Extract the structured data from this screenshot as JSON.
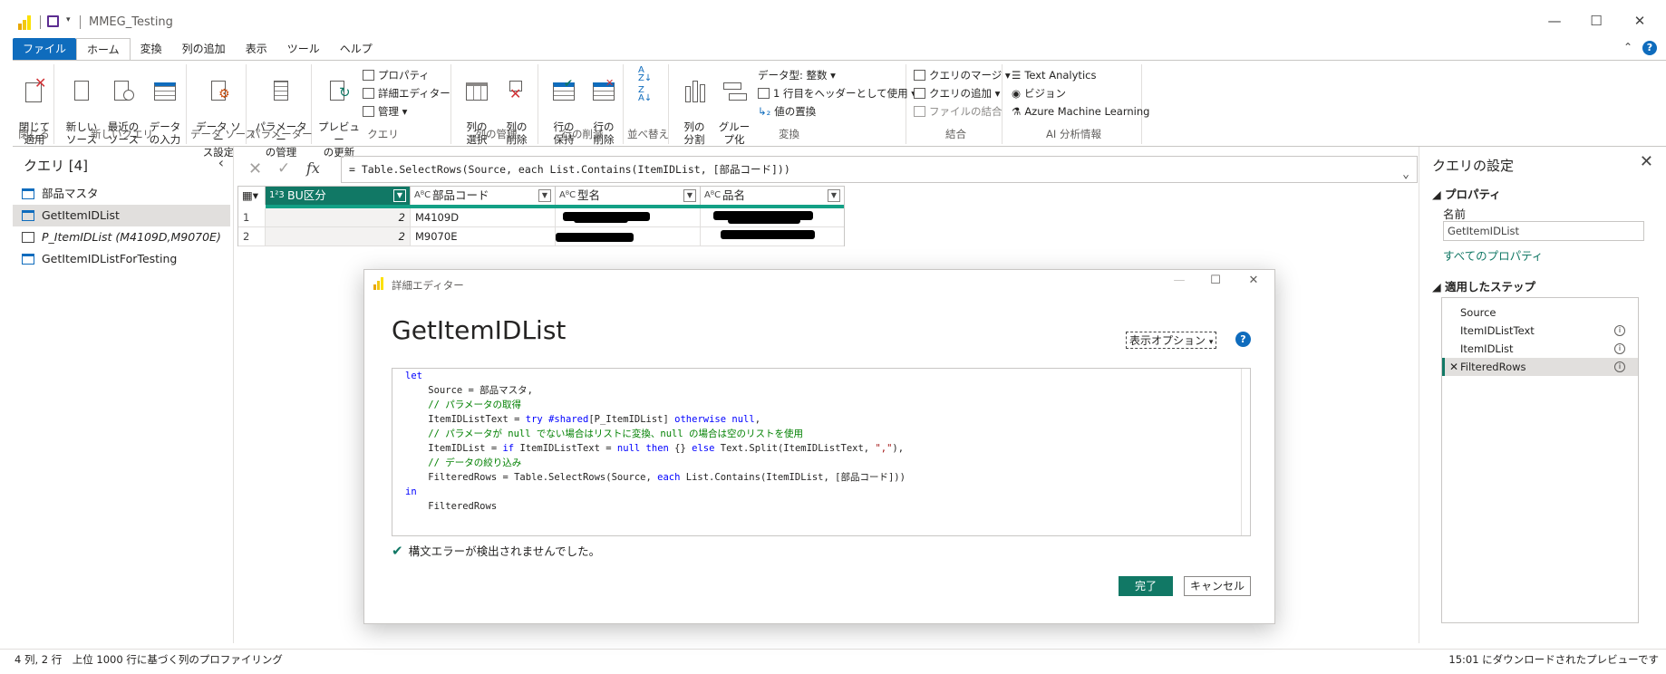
{
  "window": {
    "title": "MMEG_Testing"
  },
  "tabs": [
    "ファイル",
    "ホーム",
    "変換",
    "列の追加",
    "表示",
    "ツール",
    "ヘルプ"
  ],
  "ribbon": {
    "close_apply": "閉じて\n適用",
    "close_group": "閉じる",
    "new_source": "新しい\nソース",
    "recent_source": "最近の\nソース",
    "enter_data": "データ\nの入力",
    "new_query_group": "新しいクエリ",
    "data_source_settings": "データ ソー\nス設定",
    "data_source_group": "データ ソース",
    "manage_params": "パラメーター\nの管理",
    "params_group": "パラメーター",
    "refresh_preview": "プレビュー\nの更新",
    "properties": "プロパティ",
    "advanced_editor": "詳細エディター",
    "manage": "管理",
    "query_group": "クエリ",
    "choose_columns": "列の\n選択",
    "remove_columns": "列の\n削除",
    "manage_columns_group": "列の管理",
    "keep_rows": "行の\n保持",
    "remove_rows": "行の\n削除",
    "reduce_rows_group": "行の削減",
    "sort_group": "並べ替え",
    "split_column": "列の\n分割",
    "group_by": "グルー\nプ化",
    "data_type": "データ型: 整数",
    "first_row_header": "1 行目をヘッダーとして使用",
    "replace_values": "値の置換",
    "transform_group": "変換",
    "merge_queries": "クエリのマージ",
    "append_queries": "クエリの追加",
    "combine_files": "ファイルの結合",
    "combine_group": "結合",
    "text_analytics": "Text Analytics",
    "vision": "ビジョン",
    "azure_ml": "Azure Machine Learning",
    "ai_group": "AI 分析情報"
  },
  "queries": {
    "header": "クエリ [4]",
    "items": [
      {
        "label": "部品マスタ"
      },
      {
        "label": "GetItemIDList"
      },
      {
        "label": "P_ItemIDList (M4109D,M9070E)"
      },
      {
        "label": "GetItemIDListForTesting"
      }
    ]
  },
  "formula": {
    "fx": "fx",
    "text": "= Table.SelectRows(Source, each List.Contains(ItemIDList, [部品コード]))"
  },
  "grid": {
    "columns": [
      {
        "type": "1²3",
        "name": "BU区分"
      },
      {
        "type": "AᴮC",
        "name": "部品コード"
      },
      {
        "type": "AᴮC",
        "name": "型名"
      },
      {
        "type": "AᴮC",
        "name": "品名"
      }
    ],
    "rows": [
      {
        "n": "1",
        "bu": "2",
        "code": "M4109D"
      },
      {
        "n": "2",
        "bu": "2",
        "code": "M9070E"
      }
    ]
  },
  "settings": {
    "title": "クエリの設定",
    "properties": "プロパティ",
    "name_label": "名前",
    "name_value": "GetItemIDList",
    "all_properties": "すべてのプロパティ",
    "applied_steps": "適用したステップ",
    "steps": [
      "Source",
      "ItemIDListText",
      "ItemIDList",
      "FilteredRows"
    ]
  },
  "status": {
    "left": "4 列, 2 行　上位 1000 行に基づく列のプロファイリング",
    "right": "15:01 にダウンロードされたプレビューです"
  },
  "dialog": {
    "title": "詳細エディター",
    "heading": "GetItemIDList",
    "display_options": "表示オプション",
    "no_errors": "構文エラーが検出されませんでした。",
    "done": "完了",
    "cancel": "キャンセル"
  },
  "colors": {
    "accent": "#117865",
    "file_tab": "#0f6cbd"
  }
}
